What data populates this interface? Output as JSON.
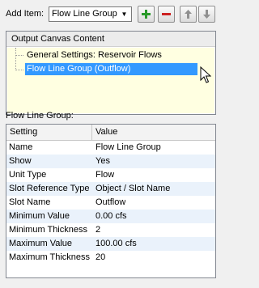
{
  "toolbar": {
    "add_item_label": "Add Item:",
    "add_item_value": "Flow Line Group",
    "add_icon": "plus-icon",
    "remove_icon": "minus-icon",
    "up_icon": "arrow-up-icon",
    "down_icon": "arrow-down-icon",
    "colors": {
      "add": "#2a9a2a",
      "remove": "#cc2222",
      "arrows": "#808080"
    }
  },
  "canvas": {
    "header": "Output Canvas Content",
    "items": [
      {
        "label": "General Settings: Reservoir Flows",
        "selected": false
      },
      {
        "label": "Flow Line Group (Outflow)",
        "selected": true
      }
    ],
    "colors": {
      "background": "#ffffe1",
      "selection": "#3399ff"
    }
  },
  "group": {
    "label": "Flow Line Group:",
    "columns": [
      "Setting",
      "Value"
    ],
    "rows": [
      {
        "setting": "Name",
        "value": "Flow Line Group"
      },
      {
        "setting": "Show",
        "value": "Yes"
      },
      {
        "setting": "Unit Type",
        "value": "Flow"
      },
      {
        "setting": "Slot Reference Type",
        "value": "Object / Slot Name"
      },
      {
        "setting": "Slot Name",
        "value": "Outflow"
      },
      {
        "setting": "Minimum Value",
        "value": "0.00 cfs"
      },
      {
        "setting": "Minimum Thickness",
        "value": "2"
      },
      {
        "setting": "Maximum Value",
        "value": "100.00 cfs"
      },
      {
        "setting": "Maximum Thickness",
        "value": "20"
      }
    ]
  }
}
